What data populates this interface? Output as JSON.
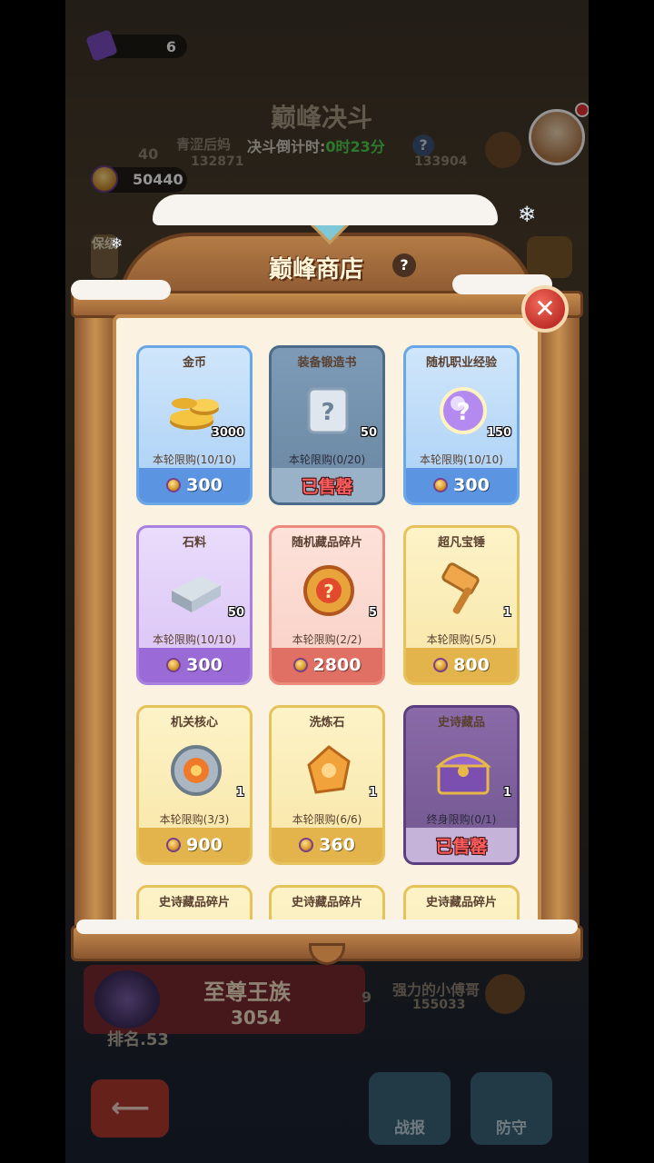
{
  "hud": {
    "ticket_count": "6",
    "trophy_points": "50440"
  },
  "background": {
    "match_title": "巅峰决斗",
    "left_level": "40",
    "left_name": "青涩后妈",
    "left_power": "132871",
    "countdown_label": "决斗倒计时:",
    "countdown_value": "0时23分",
    "right_power": "133904",
    "side_button": "保级",
    "clan_name": "至尊王族",
    "clan_score": "3054",
    "rank_label": "排名.53",
    "opponent_level": "9",
    "opponent_name": "强力的小傅哥",
    "opponent_power": "155033",
    "battle_report_label": "战报",
    "defense_label": "防守"
  },
  "shop": {
    "title": "巅峰商店",
    "items": [
      {
        "name": "金币",
        "qty": "3000",
        "limit": "本轮限购(10/10)",
        "price": "300",
        "sold_out": false,
        "theme": "blue",
        "icon": "gold-coins-icon"
      },
      {
        "name": "装备锻造书",
        "qty": "50",
        "limit": "本轮限购(0/20)",
        "price": "已售罄",
        "sold_out": true,
        "theme": "steel",
        "icon": "forge-scroll-icon"
      },
      {
        "name": "随机职业经验",
        "qty": "150",
        "limit": "本轮限购(10/10)",
        "price": "300",
        "sold_out": false,
        "theme": "blue",
        "icon": "mystery-orb-icon"
      },
      {
        "name": "石料",
        "qty": "50",
        "limit": "本轮限购(10/10)",
        "price": "300",
        "sold_out": false,
        "theme": "purple",
        "icon": "stone-ingot-icon"
      },
      {
        "name": "随机藏品碎片",
        "qty": "5",
        "limit": "本轮限购(2/2)",
        "price": "2800",
        "sold_out": false,
        "theme": "red",
        "icon": "relic-shard-icon"
      },
      {
        "name": "超凡宝锤",
        "qty": "1",
        "limit": "本轮限购(5/5)",
        "price": "800",
        "sold_out": false,
        "theme": "gold",
        "icon": "hammer-icon"
      },
      {
        "name": "机关核心",
        "qty": "1",
        "limit": "本轮限购(3/3)",
        "price": "900",
        "sold_out": false,
        "theme": "gold",
        "icon": "mechanism-core-icon"
      },
      {
        "name": "洗炼石",
        "qty": "1",
        "limit": "本轮限购(6/6)",
        "price": "360",
        "sold_out": false,
        "theme": "gold",
        "icon": "refining-stone-icon"
      },
      {
        "name": "史诗藏品",
        "qty": "1",
        "limit": "终身限购(0/1)",
        "price": "已售罄",
        "sold_out": true,
        "theme": "epic",
        "icon": "epic-chest-icon"
      },
      {
        "name": "史诗藏品碎片",
        "theme": "gold"
      },
      {
        "name": "史诗藏品碎片",
        "theme": "gold"
      },
      {
        "name": "史诗藏品碎片",
        "theme": "gold"
      }
    ]
  }
}
